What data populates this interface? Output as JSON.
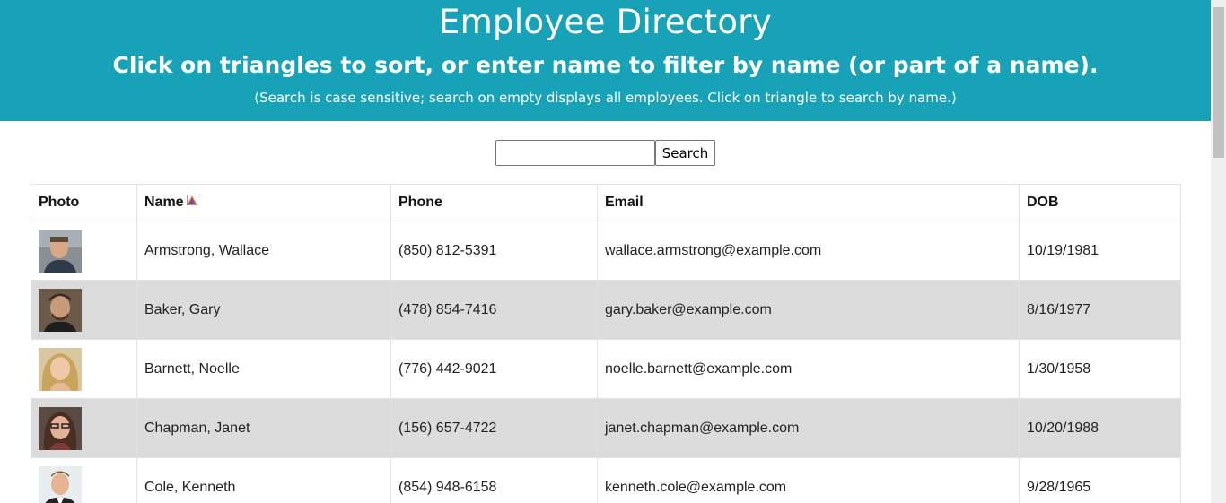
{
  "header": {
    "title": "Employee Directory",
    "subtitle": "Click on triangles to sort, or enter name to filter by name (or part of a name).",
    "note": "(Search is case sensitive; search on empty displays all employees. Click on triangle to search by name.)"
  },
  "search": {
    "value": "",
    "button_label": "Search"
  },
  "table": {
    "columns": [
      "Photo",
      "Name",
      "Phone",
      "Email",
      "DOB"
    ],
    "sort_icon": "triangle-up-icon",
    "rows": [
      {
        "name": "Armstrong, Wallace",
        "phone": "(850) 812-5391",
        "email": "wallace.armstrong@example.com",
        "dob": "10/19/1981"
      },
      {
        "name": "Baker, Gary",
        "phone": "(478) 854-7416",
        "email": "gary.baker@example.com",
        "dob": "8/16/1977"
      },
      {
        "name": "Barnett, Noelle",
        "phone": "(776) 442-9021",
        "email": "noelle.barnett@example.com",
        "dob": "1/30/1958"
      },
      {
        "name": "Chapman, Janet",
        "phone": "(156) 657-4722",
        "email": "janet.chapman@example.com",
        "dob": "10/20/1988"
      },
      {
        "name": "Cole, Kenneth",
        "phone": "(854) 948-6158",
        "email": "kenneth.cole@example.com",
        "dob": "9/28/1965"
      }
    ]
  },
  "colors": {
    "header_bg": "#17a2b8",
    "alt_row_bg": "#dcdcdc"
  }
}
